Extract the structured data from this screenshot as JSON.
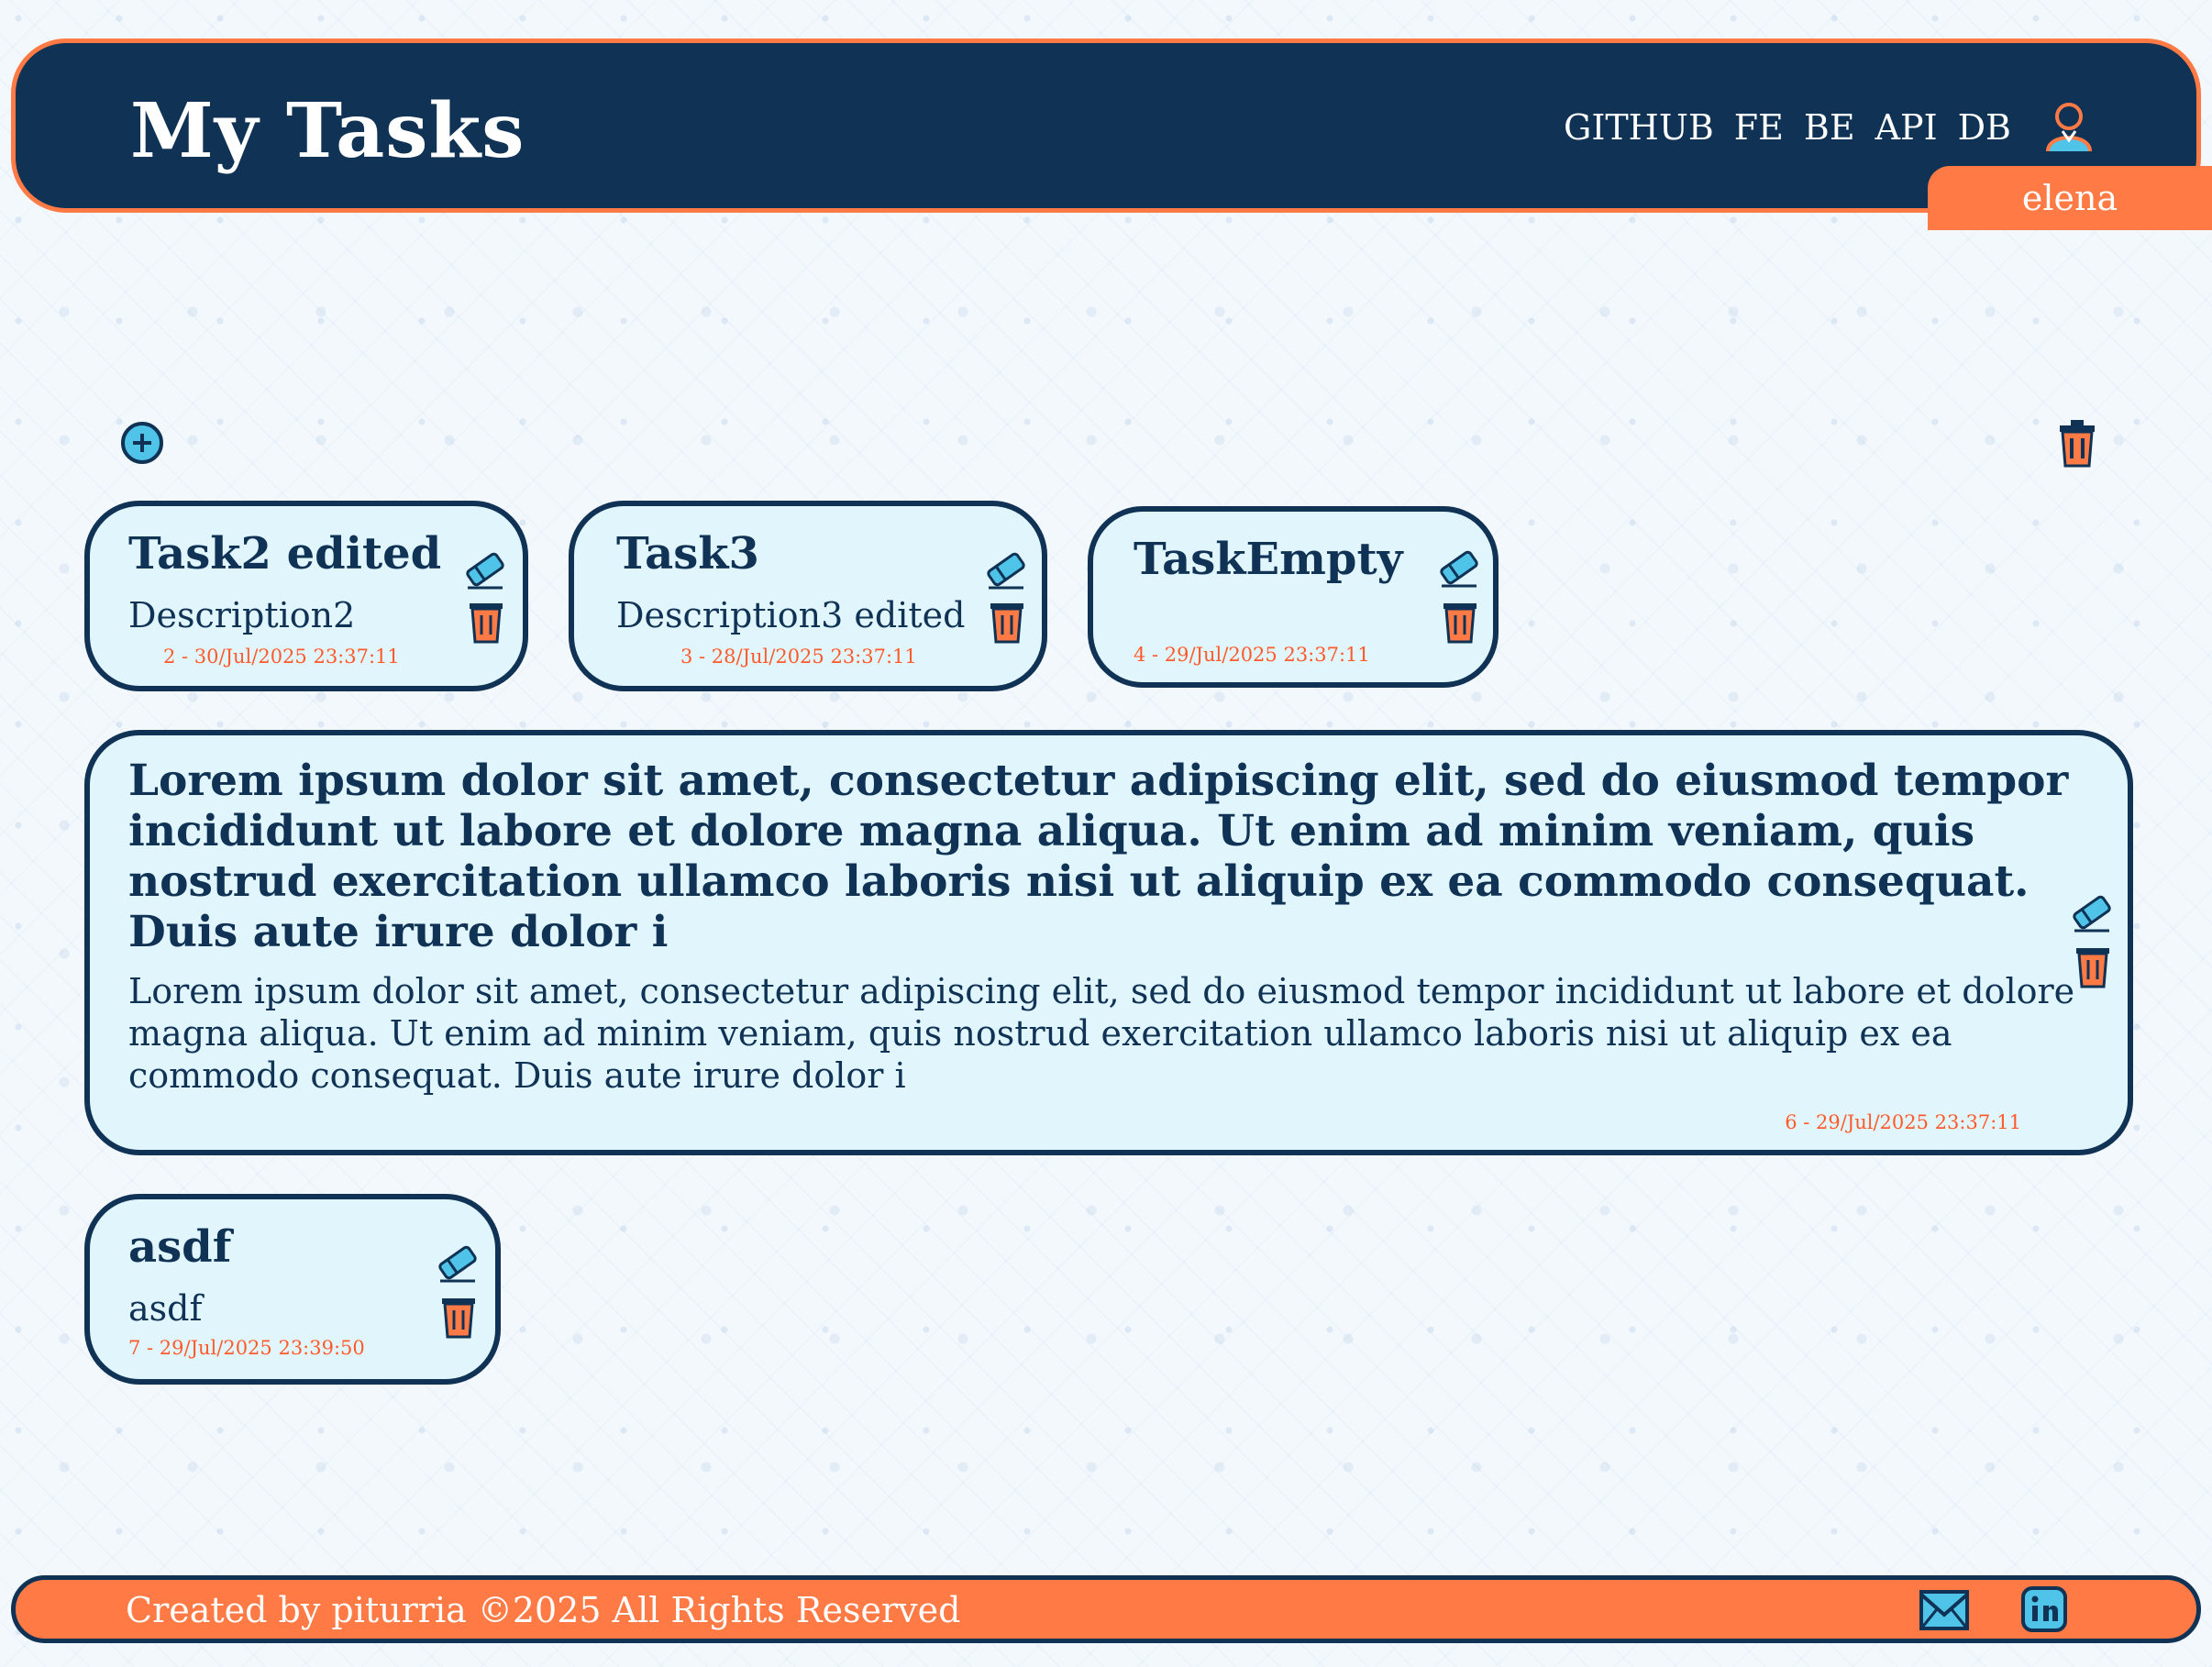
{
  "header": {
    "title": "My Tasks",
    "nav": [
      "GITHUB",
      "FE",
      "BE",
      "API",
      "DB"
    ],
    "user": "elena",
    "user_icon": "user-icon"
  },
  "actions": {
    "add_icon": "plus-circle-icon",
    "delete_all_icon": "trash-icon"
  },
  "tasks": [
    {
      "title": "Task2 edited",
      "description": "Description2",
      "meta": "2 - 30/Jul/2025 23:37:11"
    },
    {
      "title": "Task3",
      "description": "Description3 edited",
      "meta": "3 - 28/Jul/2025 23:37:11"
    },
    {
      "title": "TaskEmpty",
      "description": "",
      "meta": "4 - 29/Jul/2025 23:37:11"
    },
    {
      "title": "Lorem ipsum dolor sit amet, consectetur adipiscing elit, sed do eiusmod tempor incididunt ut labore et dolore magna aliqua. Ut enim ad minim veniam, quis nostrud exercitation ullamco laboris nisi ut aliquip ex ea commodo consequat. Duis aute irure dolor i",
      "description": "Lorem ipsum dolor sit amet, consectetur adipiscing elit, sed do eiusmod tempor incididunt ut labore et dolore magna aliqua. Ut enim ad minim veniam, quis nostrud exercitation ullamco laboris nisi ut aliquip ex ea commodo consequat. Duis aute irure dolor i",
      "meta": "6 - 29/Jul/2025 23:37:11"
    },
    {
      "title": "asdf",
      "description": "asdf",
      "meta": "7 - 29/Jul/2025 23:39:50"
    }
  ],
  "footer": {
    "text": "Created by piturria ©2025 All Rights Reserved",
    "icons": [
      "mail-icon",
      "linkedin-icon"
    ]
  },
  "colors": {
    "navy": "#0f3255",
    "orange": "#ff7a45",
    "card_bg": "#e1f6fc",
    "meta": "#ff5a2c"
  }
}
